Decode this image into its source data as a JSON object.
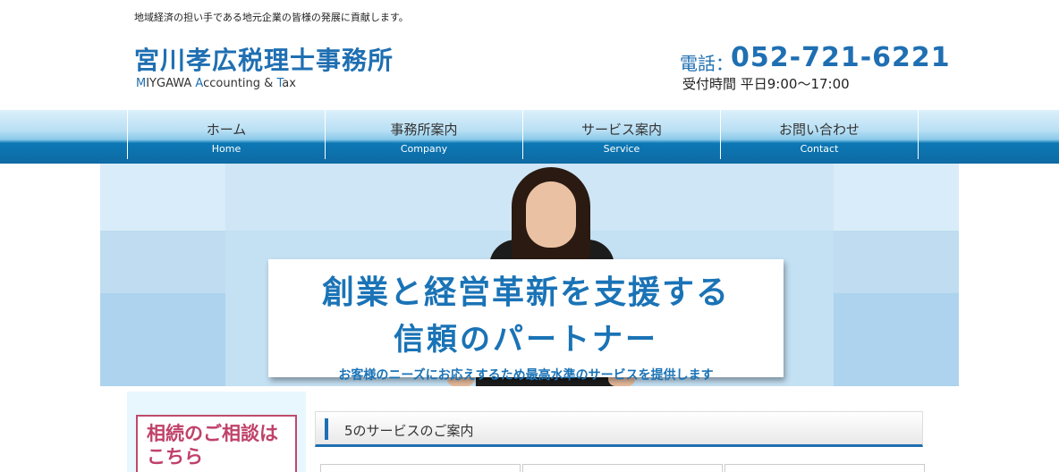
{
  "header": {
    "tagline": "地域経済の担い手である地元企業の皆様の発展に貢献します。",
    "logo_title": "宮川孝広税理士事務所",
    "logo_sub": {
      "p1h": "M",
      "p1": "IYGAWA ",
      "p2h": "A",
      "p2": "ccounting & ",
      "p3h": "T",
      "p3": "ax"
    },
    "phone_label": "電話：",
    "phone_number": "052-721-6221",
    "hours": "受付時間 平日9:00～17:00"
  },
  "nav": {
    "items": [
      {
        "jp": "ホーム",
        "en": "Home"
      },
      {
        "jp": "事務所案内",
        "en": "Company"
      },
      {
        "jp": "サービス案内",
        "en": "Service"
      },
      {
        "jp": "お問い合わせ",
        "en": "Contact"
      }
    ]
  },
  "hero": {
    "line1": "創業と経営革新を支援する",
    "line2": "信頼のパートナー",
    "line3": "お客様のニーズにお応えするため最高水準のサービスを提供します"
  },
  "sidebar": {
    "inherit_line1": "相続のご相談は",
    "inherit_line2": "こちら"
  },
  "main": {
    "section_title": "5のサービスのご案内"
  },
  "colors": {
    "brand_blue": "#1f6fb2",
    "accent_pink": "#c0416a"
  }
}
